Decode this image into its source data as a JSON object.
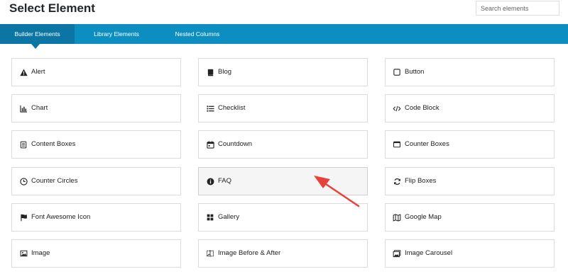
{
  "header": {
    "title": "Select Element",
    "search_placeholder": "Search elements"
  },
  "tabs": [
    {
      "label": "Builder Elements",
      "active": true
    },
    {
      "label": "Library Elements",
      "active": false
    },
    {
      "label": "Nested Columns",
      "active": false
    }
  ],
  "colors": {
    "tab_bar": "#0d8ec0",
    "tab_active": "#0b76a3",
    "annotation_arrow": "#e8413c"
  },
  "elements": [
    {
      "label": "Alert",
      "icon": "warning-icon"
    },
    {
      "label": "Blog",
      "icon": "book-icon"
    },
    {
      "label": "Button",
      "icon": "square-outline-icon"
    },
    {
      "label": "Chart",
      "icon": "bar-chart-icon"
    },
    {
      "label": "Checklist",
      "icon": "list-icon"
    },
    {
      "label": "Code Block",
      "icon": "code-icon"
    },
    {
      "label": "Content Boxes",
      "icon": "document-icon"
    },
    {
      "label": "Countdown",
      "icon": "calendar-icon"
    },
    {
      "label": "Counter Boxes",
      "icon": "window-icon"
    },
    {
      "label": "Counter Circles",
      "icon": "clock-icon"
    },
    {
      "label": "FAQ",
      "icon": "info-icon",
      "highlighted": true
    },
    {
      "label": "Flip Boxes",
      "icon": "refresh-icon"
    },
    {
      "label": "Font Awesome Icon",
      "icon": "flag-icon"
    },
    {
      "label": "Gallery",
      "icon": "grid-icon"
    },
    {
      "label": "Google Map",
      "icon": "map-icon"
    },
    {
      "label": "Image",
      "icon": "image-icon"
    },
    {
      "label": "Image Before & After",
      "icon": "image-compare-icon"
    },
    {
      "label": "Image Carousel",
      "icon": "image-carousel-icon"
    }
  ]
}
